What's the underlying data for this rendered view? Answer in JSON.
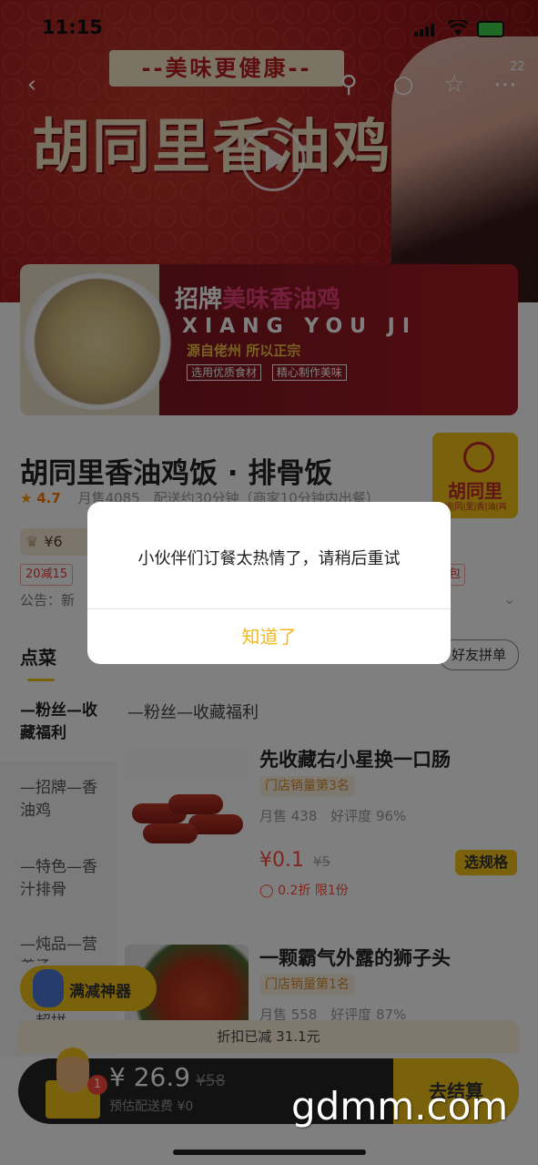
{
  "status_bar": {
    "time": "11:15"
  },
  "hero": {
    "tagline": "--美味更健康--",
    "title": "胡同里香油鸡",
    "icon_count": "22"
  },
  "banner2": {
    "title_prefix": "招牌",
    "title_highlight": "美味香油鸡",
    "pinyin": "XIANG YOU JI",
    "sub": "源自佬州 所以正宗",
    "tags": [
      "选用优质食材",
      "精心制作美味"
    ]
  },
  "store": {
    "name": "胡同里香油鸡饭 · 排骨饭",
    "rating": "4.7",
    "monthly_sales": "月售4085",
    "delivery": "配送约30分钟（商家10分钟内出餐）",
    "vip_amount": "¥6",
    "coupon": "20减15",
    "coupon_right": "包",
    "notice": "公告：新",
    "logo_text": "胡同里",
    "logo_sub": "胡|同|里|香|油|鸡"
  },
  "tabs": {
    "dish": "点菜",
    "group": "好友拼单"
  },
  "sidebar": [
    {
      "label": "—粉丝—收藏福利"
    },
    {
      "label": "—招牌—香油鸡"
    },
    {
      "label": "—特色—香汁排骨"
    },
    {
      "label": "—炖品—营养汤"
    },
    {
      "label": "—超拼—"
    }
  ],
  "section_title": "—粉丝—收藏福利",
  "dishes": [
    {
      "name": "先收藏右小星换一口肠",
      "rank": "门店销量第3名",
      "sales": "月售 438",
      "rating": "好评度 96%",
      "price": "¥0.1",
      "old_price": "¥5",
      "discount": "0.2折  限1份",
      "spec": "选规格"
    },
    {
      "name": "一颗霸气外露的狮子头",
      "rank": "门店销量第1名",
      "sales": "月售 558",
      "rating": "好评度 87%"
    }
  ],
  "bottom": {
    "mj_label": "满减神器",
    "saved": "折扣已减 31.1元",
    "cart_count": "1",
    "total": "¥ 26.9",
    "total_old": "¥58",
    "delivery_fee": "预估配送费 ¥0",
    "checkout": "去结算"
  },
  "dialog": {
    "message": "小伙伴们订餐太热情了，请稍后重试",
    "ok": "知道了"
  },
  "watermark": "gdmm.com"
}
